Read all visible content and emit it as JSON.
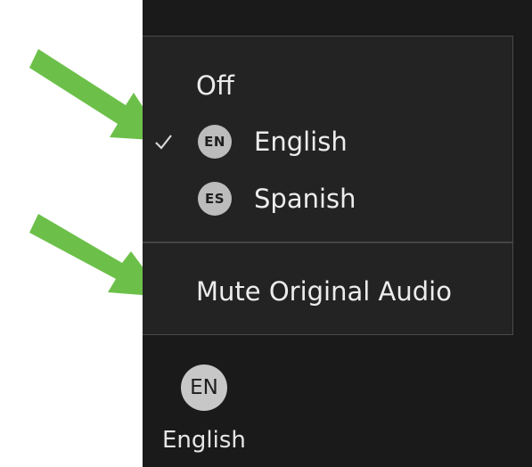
{
  "colors": {
    "panel_background": "#1a1a1a",
    "menu_background": "#232323",
    "menu_text": "#ececec",
    "badge_background": "#bcbcbc",
    "arrow_green": "#6cc04a"
  },
  "menu": {
    "items": [
      {
        "label": "Off",
        "checked": false
      },
      {
        "label": "English",
        "badge": "EN",
        "checked": true
      },
      {
        "label": "Spanish",
        "badge": "ES",
        "checked": false
      }
    ],
    "mute_label": "Mute Original Audio"
  },
  "toolbar": {
    "language_badge": "EN",
    "language_label": "English"
  },
  "annotations": {
    "arrows": [
      "green-arrow",
      "green-arrow"
    ]
  }
}
